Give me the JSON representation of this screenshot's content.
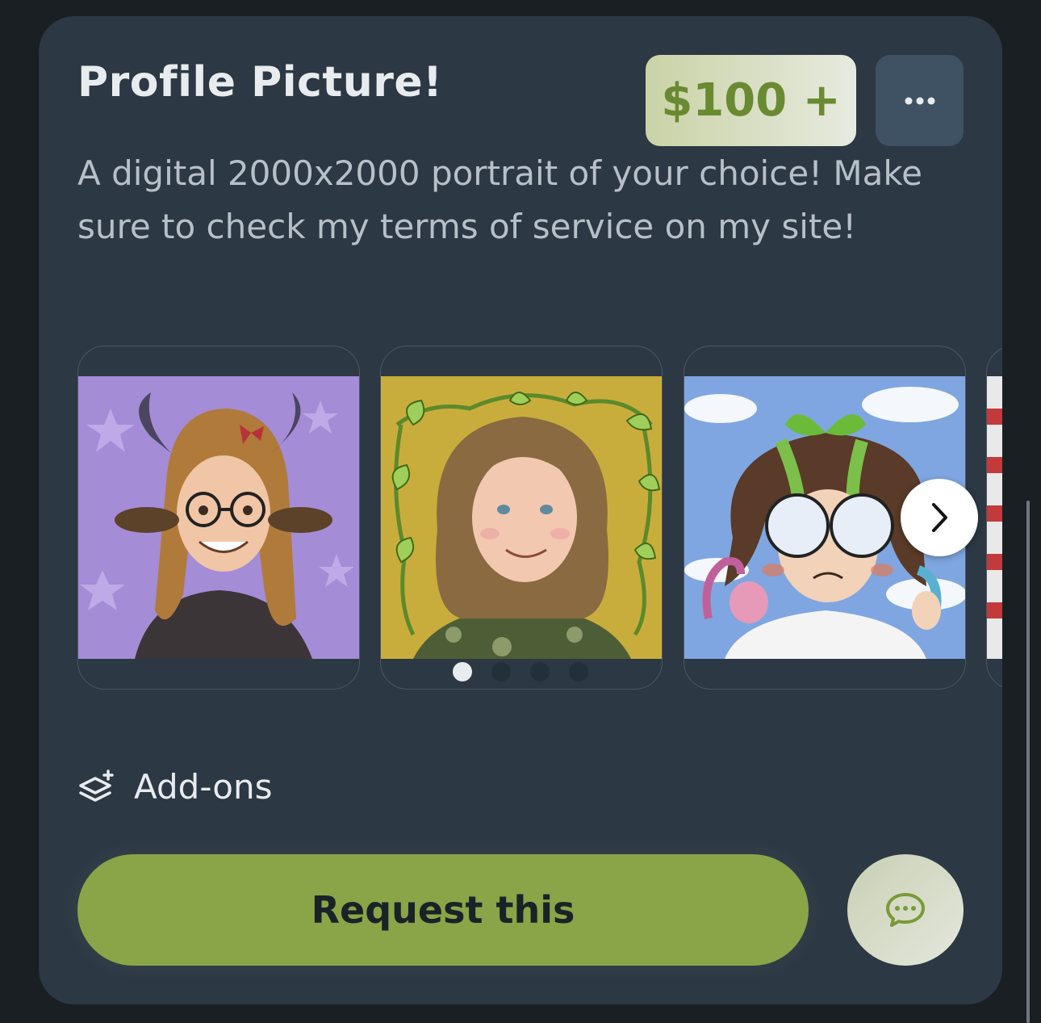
{
  "card": {
    "title": "Profile Picture!",
    "price": "$100 +",
    "more_label": "...",
    "description": "A digital 2000x2000 portrait of your choice! Make sure to check my terms of service on my site!"
  },
  "gallery": {
    "slides": [
      {
        "icon": "portrait-horned-girl-glasses-image"
      },
      {
        "icon": "portrait-vines-woman-image"
      },
      {
        "icon": "portrait-sprout-character-image"
      },
      {
        "icon": "portrait-striped-partial-image"
      }
    ],
    "dots_total": 4,
    "active_dot": 1,
    "next_icon": "chevron-right-icon"
  },
  "addons": {
    "label": "Add-ons",
    "icon": "layers-plus-icon"
  },
  "actions": {
    "request_label": "Request this",
    "chat_icon": "chat-bubble-icon"
  },
  "colors": {
    "card_bg": "#2c3843",
    "accent_green": "#89a548",
    "price_text": "#6a8a32"
  }
}
